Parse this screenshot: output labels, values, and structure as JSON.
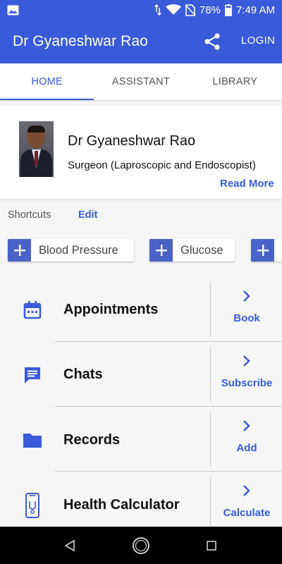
{
  "status_bar": {
    "battery": "78%",
    "time": "7:49 AM",
    "icons": [
      "gallery-icon",
      "data-arrows-icon",
      "wifi-icon",
      "no-sim-icon",
      "battery-icon"
    ]
  },
  "app_bar": {
    "title": "Dr Gyaneshwar Rao",
    "share_icon": "share-icon",
    "login_label": "LOGIN"
  },
  "tabs": [
    {
      "label": "HOME",
      "active": true
    },
    {
      "label": "ASSISTANT",
      "active": false
    },
    {
      "label": "LIBRARY",
      "active": false
    }
  ],
  "doctor": {
    "name": "Dr Gyaneshwar Rao",
    "specialty": "Surgeon (Laproscopic and Endoscopist)",
    "read_more": "Read More"
  },
  "shortcuts": {
    "label": "Shortcuts",
    "edit": "Edit",
    "chips": [
      {
        "label": "Blood Pressure"
      },
      {
        "label": "Glucose"
      },
      {
        "label": ""
      }
    ]
  },
  "features": [
    {
      "title": "Appointments",
      "action": "Book",
      "icon": "calendar-icon"
    },
    {
      "title": "Chats",
      "action": "Subscribe",
      "icon": "chat-icon"
    },
    {
      "title": "Records",
      "action": "Add",
      "icon": "folder-icon"
    },
    {
      "title": "Health Calculator",
      "action": "Calculate",
      "icon": "health-calculator-icon"
    }
  ],
  "colors": {
    "primary": "#3a5bd9",
    "chip_plus": "#4a63c8",
    "background": "#f6f6f6"
  }
}
